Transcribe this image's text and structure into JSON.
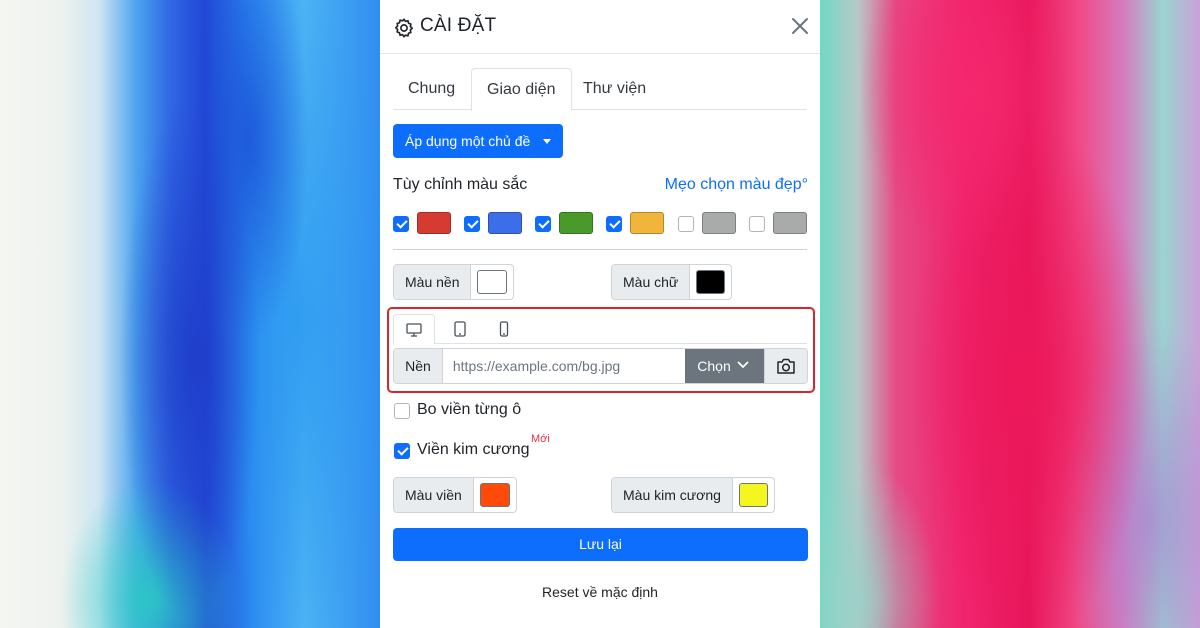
{
  "dialog": {
    "title": "CÀI ĐẶT",
    "tabs": [
      {
        "label": "Chung"
      },
      {
        "label": "Giao diện"
      },
      {
        "label": "Thư viện"
      }
    ],
    "active_tab": "Giao diện"
  },
  "theme_button": {
    "label": "Áp dụng một chủ đề"
  },
  "colors_section": {
    "label": "Tùy chỉnh màu sắc",
    "tip_link": "Mẹo chọn màu đẹp°",
    "swatches": [
      {
        "checked": true,
        "color": "#d63b32"
      },
      {
        "checked": true,
        "color": "#3b6ee8"
      },
      {
        "checked": true,
        "color": "#4a9a2b"
      },
      {
        "checked": true,
        "color": "#f0b53a"
      },
      {
        "checked": false,
        "color": "#a9abab"
      },
      {
        "checked": false,
        "color": "#a9abab"
      }
    ]
  },
  "background_color": {
    "label": "Màu nền",
    "value": "#ffffff"
  },
  "text_color": {
    "label": "Màu chữ",
    "value": "#000000"
  },
  "background_image": {
    "devices": [
      "desktop-icon",
      "tablet-icon",
      "phone-icon"
    ],
    "label": "Nền",
    "placeholder": "https://example.com/bg.jpg",
    "choose_label": "Chọn"
  },
  "cell_border": {
    "label": "Bo viền từng ô",
    "checked": false
  },
  "diamond_border": {
    "label": "Viền kim cương",
    "badge": "Mới",
    "checked": true
  },
  "border_color": {
    "label": "Màu viền",
    "value": "#ff4a0a"
  },
  "diamond_color": {
    "label": "Màu kim cương",
    "value": "#f5f51f"
  },
  "save_button": {
    "label": "Lưu lại"
  },
  "reset_link": {
    "label": "Reset về mặc định"
  }
}
